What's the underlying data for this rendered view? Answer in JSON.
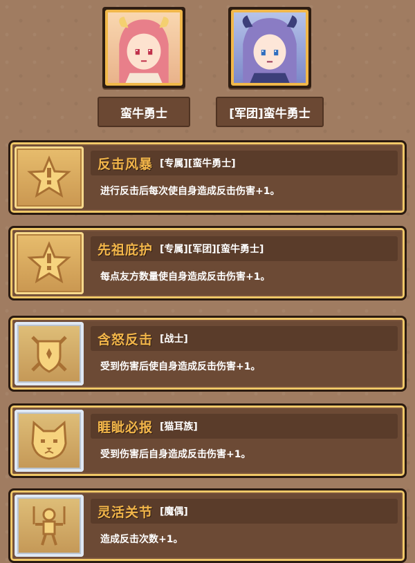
{
  "heroes": [
    {
      "name": "蛮牛勇士",
      "portrait_icon": "pink-hair-horned-girl-portrait"
    },
    {
      "name": "[军团]蛮牛勇士",
      "portrait_icon": "purple-hair-horned-girl-portrait"
    }
  ],
  "traits": [
    {
      "name": "反击风暴",
      "tags": "[专属][蛮牛勇士]",
      "description": "进行反击后每次使自身造成反击伤害+1。",
      "icon": "star-icon",
      "frame": "gold"
    },
    {
      "name": "先祖庇护",
      "tags": "[专属][军团][蛮牛勇士]",
      "description": "每点友方数量使自身造成反击伤害+1。",
      "icon": "star-icon",
      "frame": "gold"
    },
    {
      "name": "含怒反击",
      "tags": "[战士]",
      "description": "受到伤害后使自身造成反击伤害+1。",
      "icon": "shield-swords-icon",
      "frame": "silver"
    },
    {
      "name": "睚眦必报",
      "tags": "[猫耳族]",
      "description": "受到伤害后自身造成反击伤害+1。",
      "icon": "cat-face-icon",
      "frame": "silver"
    },
    {
      "name": "灵活关节",
      "tags": "[魔偶]",
      "description": "造成反击次数+1。",
      "icon": "puppet-icon",
      "frame": "silver"
    }
  ],
  "colors": {
    "background": "#a07c61",
    "card": "#6c4a35",
    "gold_border": "#f0c868",
    "trait_name": "#f3b64a",
    "text": "#ffffff"
  }
}
